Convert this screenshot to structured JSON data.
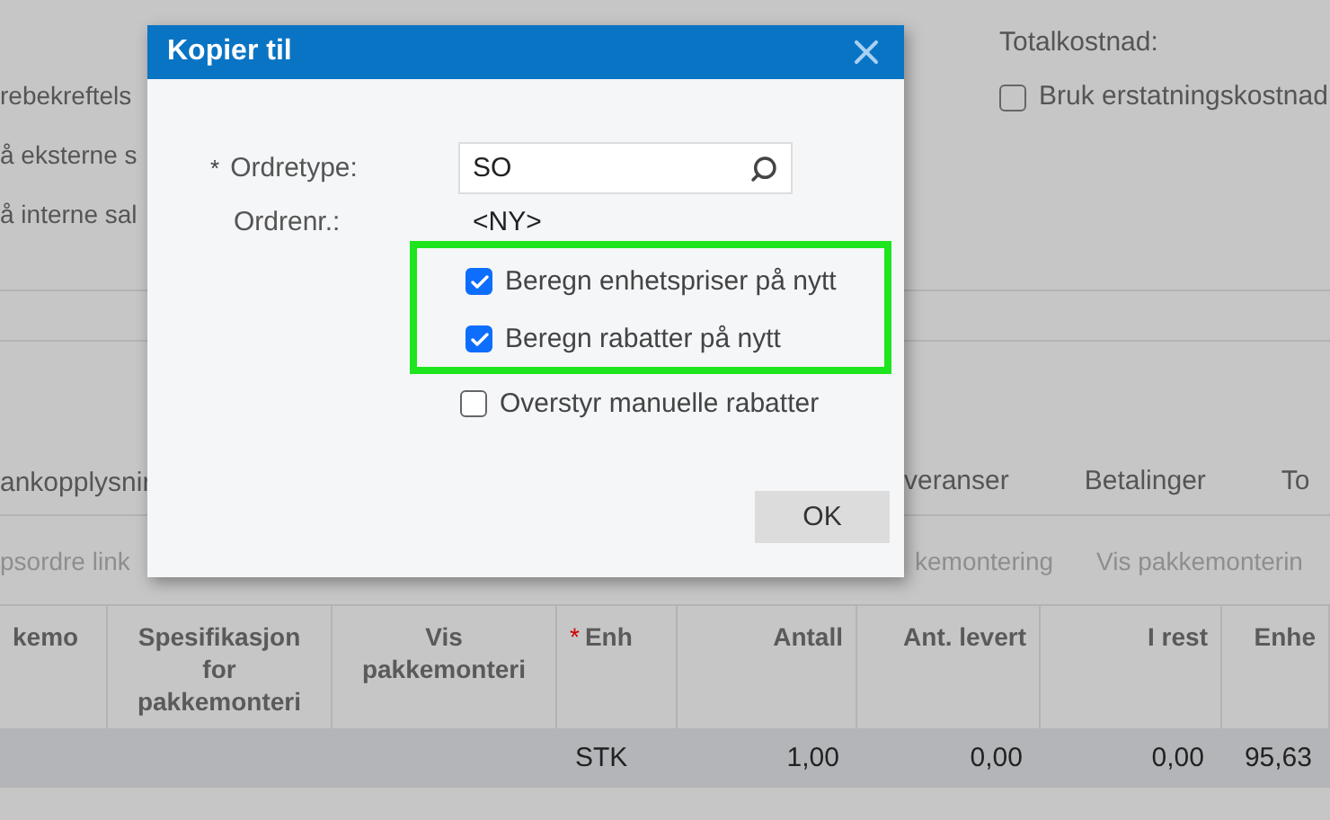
{
  "background": {
    "left_texts": [
      "rebekreftels",
      "å eksterne s",
      "å interne sal"
    ],
    "total_label": "Totalkostnad:",
    "replacement_cost": {
      "label": "Bruk erstatningskostnad",
      "checked": false
    },
    "tabs": [
      {
        "label": "ankopplysnir",
        "selected": false
      },
      {
        "label": "veranser",
        "selected": false
      },
      {
        "label": "Betalinger",
        "selected": false
      },
      {
        "label": "To",
        "selected": false
      }
    ],
    "toolbar": [
      {
        "label": "psordre link",
        "disabled": true
      },
      {
        "label": "kemontering",
        "disabled": true
      },
      {
        "label": "Vis pakkemonterin",
        "disabled": true
      }
    ],
    "table": {
      "columns": [
        {
          "label": "kemo",
          "numeric": false
        },
        {
          "label": "Spesifikasjon for pakkemonteri",
          "numeric": false
        },
        {
          "label": "Vis pakkemonteri",
          "numeric": false
        },
        {
          "label": "Enh",
          "numeric": false,
          "required_mark": "*"
        },
        {
          "label": "Antall",
          "numeric": true
        },
        {
          "label": "Ant. levert",
          "numeric": true
        },
        {
          "label": "I rest",
          "numeric": true
        },
        {
          "label": "Enhe",
          "numeric": true
        }
      ],
      "rows": [
        {
          "selected": true,
          "cells": [
            "",
            "",
            "",
            "STK",
            "1,00",
            "0,00",
            "0,00",
            "95,63"
          ]
        }
      ]
    }
  },
  "dialog": {
    "title": "Kopier til",
    "order_type": {
      "label": "Ordretype:",
      "required_mark": "*",
      "value": "SO"
    },
    "order_number": {
      "label": "Ordrenr.:",
      "value": "<NY>"
    },
    "highlighted_options": [
      {
        "label": "Beregn enhetspriser på nytt",
        "checked": true
      },
      {
        "label": "Beregn rabatter på nytt",
        "checked": true
      }
    ],
    "options": [
      {
        "label": "Overstyr manuelle rabatter",
        "checked": false
      }
    ],
    "button": "OK"
  }
}
